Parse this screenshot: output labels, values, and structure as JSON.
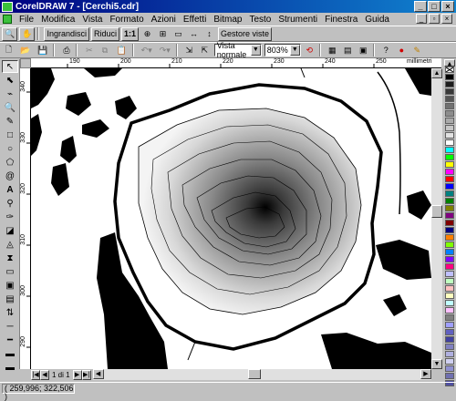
{
  "window": {
    "title": "CorelDRAW 7 - [Cerchi5.cdr]"
  },
  "menu": [
    "File",
    "Modifica",
    "Vista",
    "Formato",
    "Azioni",
    "Effetti",
    "Bitmap",
    "Testo",
    "Strumenti",
    "Finestra",
    "Guida"
  ],
  "toolbar1": {
    "zoom_in": "Ingrandisci",
    "zoom_out": "Riduci",
    "actual": "1:1",
    "view_manager": "Gestore viste"
  },
  "toolbar2": {
    "view_mode": "Vista normale",
    "zoom": "803%"
  },
  "rulers": {
    "h_ticks": [
      "190",
      "200",
      "210",
      "220",
      "230",
      "240",
      "250"
    ],
    "h_unit": "millimetri",
    "v_ticks": [
      "340",
      "330",
      "320",
      "310",
      "300",
      "290"
    ],
    "v_unit": "millimetri"
  },
  "page": {
    "current": "1 di 1"
  },
  "status": {
    "coords": "( 259,996; 322,506 )"
  },
  "palette": [
    "#000000",
    "#1c1c1c",
    "#383838",
    "#555555",
    "#717171",
    "#8d8d8d",
    "#aaaaaa",
    "#c6c6c6",
    "#e2e2e2",
    "#ffffff",
    "#00ffff",
    "#00ff00",
    "#ffff00",
    "#ff00ff",
    "#ff0000",
    "#0000ff",
    "#008080",
    "#008000",
    "#808000",
    "#800080",
    "#800000",
    "#000080",
    "#ff8000",
    "#80ff00",
    "#0080ff",
    "#8000ff",
    "#ff0080",
    "#c0c0ff",
    "#c0ffc0",
    "#ffc0c0",
    "#ffffc0",
    "#c0ffff",
    "#ffc0ff",
    "#808080",
    "#a0a0ff",
    "#6060c0",
    "#4040a0",
    "#8080c0",
    "#b0b0e0",
    "#d0d0f0",
    "#9090d0",
    "#7070b0",
    "#5050a0"
  ]
}
